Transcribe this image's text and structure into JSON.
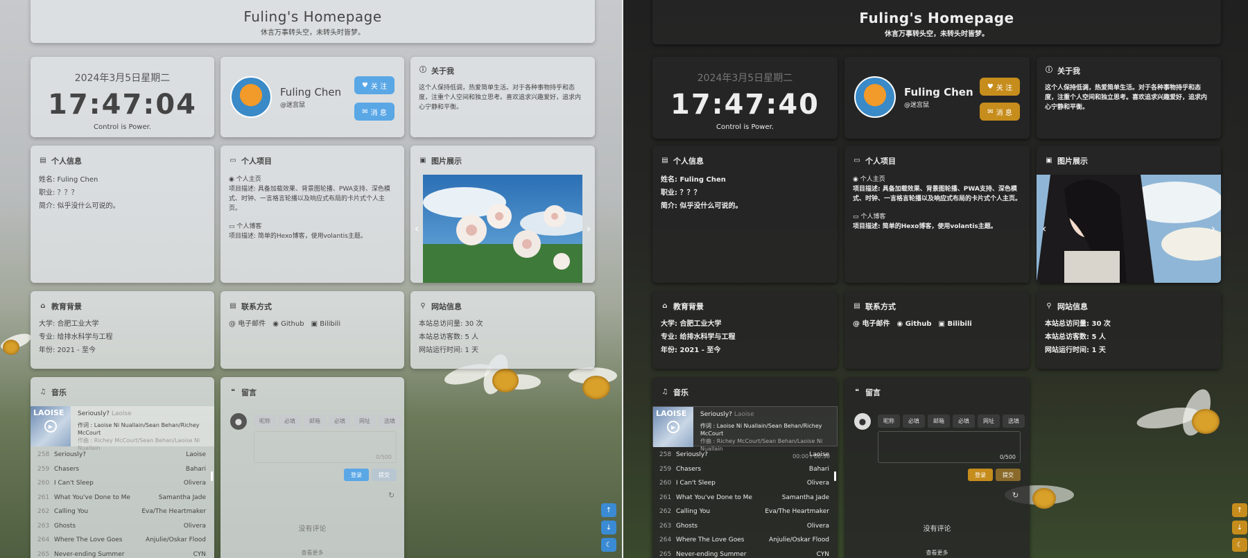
{
  "site": {
    "title": "Fuling's Homepage",
    "subtitle": "休言万事转头空，未转头时皆梦。"
  },
  "light": {
    "time": "17:47:04"
  },
  "dark": {
    "time": "17:47:40"
  },
  "clock": {
    "date": "2024年3月5日星期二",
    "motto": "Control is Power."
  },
  "profile": {
    "name": "Fuling Chen",
    "handle": "@迷宫鼠",
    "follow_label": "关 注",
    "message_label": "消 息"
  },
  "about": {
    "title": "关于我",
    "text": "这个人保持低调，热爱简单生活。对于各种事物持乎和态度，注重个人空间和独立思考。喜欢追求兴趣爱好，追求内心宁静和平衡。"
  },
  "info": {
    "title": "个人信息",
    "lines": [
      "姓名: Fuling Chen",
      "职业: ？？？",
      "简介: 似乎没什么可说的。"
    ]
  },
  "projects": {
    "title": "个人项目",
    "items": [
      {
        "name": "个人主页",
        "desc": "项目描述: 具备加载效果、背景图轮播、PWA支持、深色模式、时钟、一言格言轮播以及响应式布局的卡片式个人主页。"
      },
      {
        "name": "个人博客",
        "desc": "项目描述: 简单的Hexo博客，使用volantis主题。"
      }
    ]
  },
  "gallery": {
    "title": "图片展示"
  },
  "education": {
    "title": "教育背景",
    "lines": [
      "大学: 合肥工业大学",
      "专业: 给排水科学与工程",
      "年份: 2021 - 至今"
    ]
  },
  "contact": {
    "title": "联系方式",
    "items": [
      "电子邮件",
      "Github",
      "Bilibili"
    ]
  },
  "stats": {
    "title": "网站信息",
    "lines": [
      "本站总访问量: 30 次",
      "本站总访客数: 5 人",
      "网站运行时间:  1 天"
    ]
  },
  "music": {
    "title": "音乐",
    "cover_text": "LAOISE",
    "now_title": "Seriously?",
    "now_artist": "Laoise",
    "lyric1": "作词 : Laoise Ni Nuallain/Sean Behan/Richey McCourt",
    "lyric2": "作曲 : Richey McCourt/Sean Behan/Laoise Ni Nuallain",
    "time": "00:00 / 00:30",
    "songs": [
      {
        "n": "258",
        "t": "Seriously?",
        "a": "Laoise"
      },
      {
        "n": "259",
        "t": "Chasers",
        "a": "Bahari"
      },
      {
        "n": "260",
        "t": "I Can't Sleep",
        "a": "Olivera"
      },
      {
        "n": "261",
        "t": "What You've Done to Me",
        "a": "Samantha Jade"
      },
      {
        "n": "262",
        "t": "Calling You",
        "a": "Eva/The Heartmaker"
      },
      {
        "n": "263",
        "t": "Ghosts",
        "a": "Olivera"
      },
      {
        "n": "264",
        "t": "Where The Love Goes",
        "a": "Anjulie/Oskar Flood"
      },
      {
        "n": "265",
        "t": "Never-ending Summer",
        "a": "CYN"
      }
    ]
  },
  "comments": {
    "title": "留言",
    "tabs": [
      "昵称",
      "必填",
      "邮箱",
      "必填",
      "网址",
      "选填"
    ],
    "count": "0/500",
    "submit": "提交",
    "login": "登录",
    "empty": "没有评论",
    "more": "查看更多"
  },
  "colors": {
    "light_accent": "#5aa7e6",
    "dark_accent": "#c68d1c"
  },
  "icons": [
    "heart-icon",
    "mail-icon",
    "info-icon",
    "id-card-icon",
    "folder-icon",
    "image-icon",
    "graduation-cap-icon",
    "contact-card-icon",
    "user-icon",
    "music-icon",
    "comments-icon",
    "github-icon",
    "bilibili-icon",
    "at-icon",
    "monitor-icon",
    "arrow-up-icon",
    "arrow-down-icon",
    "moon-icon",
    "refresh-icon"
  ]
}
